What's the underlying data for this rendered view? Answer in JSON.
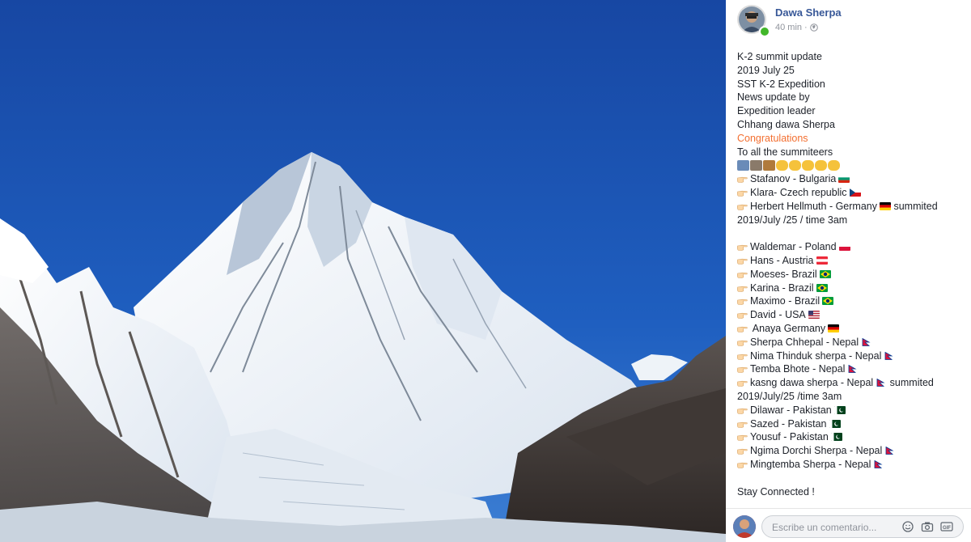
{
  "author": {
    "name": "Dawa Sherpa",
    "time": "40 min",
    "separator": "·",
    "privacy_icon": "globe-icon"
  },
  "post": {
    "intro": [
      "K-2 summit update",
      "2019 July 25",
      "SST K-2 Expedition",
      "News update by",
      "Expedition leader",
      "Chhang dawa Sherpa"
    ],
    "highlight": "Congratulations",
    "subhead": "To all the summiteers",
    "group1": [
      {
        "text": "Stafanov - Bulgaria",
        "flag": "bulgaria"
      },
      {
        "text": "Klara- Czech republic",
        "flag": "czech"
      },
      {
        "text": "Herbert Hellmuth - Germany",
        "flag": "germany",
        "suffix": "summited"
      }
    ],
    "time1": "2019/July /25 / time 3am",
    "group2": [
      {
        "text": "Waldemar - Poland",
        "flag": "poland"
      },
      {
        "text": "Hans - Austria",
        "flag": "austria"
      },
      {
        "text": "Moeses- Brazil",
        "flag": "brazil"
      },
      {
        "text": "Karina - Brazil",
        "flag": "brazil"
      },
      {
        "text": "Maximo - Brazil",
        "flag": "brazil"
      },
      {
        "text": "David - USA",
        "flag": "usa"
      },
      {
        "text": " Anaya Germany",
        "flag": "germany"
      },
      {
        "text": "Sherpa Chhepal - Nepal",
        "flag": "nepal"
      },
      {
        "text": "Nima Thinduk sherpa - Nepal",
        "flag": "nepal"
      },
      {
        "text": "Temba Bhote - Nepal",
        "flag": "nepal"
      },
      {
        "text": "kasng dawa sherpa - Nepal",
        "flag": "nepal",
        "suffix": "summited"
      }
    ],
    "time2": "2019/July/25 /time 3am",
    "group3": [
      {
        "text": "Dilawar - Pakistan",
        "flag": "pakistan"
      },
      {
        "text": "Sazed - Pakistan",
        "flag": "pakistan"
      },
      {
        "text": "Yousuf - Pakistan",
        "flag": "pakistan"
      },
      {
        "text": "Ngima Dorchi Sherpa - Nepal",
        "flag": "nepal"
      },
      {
        "text": "Mingtemba Sherpa - Nepal",
        "flag": "nepal"
      }
    ],
    "closing": "Stay Connected !"
  },
  "comment": {
    "placeholder": "Escribe un comentario...",
    "icons": [
      "emoji-icon",
      "camera-icon",
      "gif-icon",
      "sticker-icon"
    ]
  },
  "colors": {
    "link": "#385898",
    "accent": "#f36f30",
    "sky": "#1b4fa8"
  }
}
